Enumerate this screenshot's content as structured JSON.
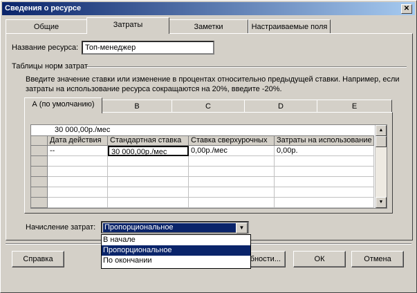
{
  "window": {
    "title": "Сведения о ресурсе",
    "close_glyph": "✕"
  },
  "tabs": [
    {
      "label": "Общие"
    },
    {
      "label": "Затраты"
    },
    {
      "label": "Заметки"
    },
    {
      "label": "Настраиваемые поля"
    }
  ],
  "resource": {
    "name_label": "Название ресурса:",
    "name_value": "Топ-менеджер"
  },
  "rates": {
    "group_label": "Таблицы норм затрат",
    "instruction_1": "Введите значение ставки или изменение в процентах относительно предыдущей ставки. Например, если",
    "instruction_2": "затраты на использование ресурса сокращаются на 20%, введите -20%.",
    "tabs": [
      {
        "label": "А (по умолчанию)"
      },
      {
        "label": "B"
      },
      {
        "label": "C"
      },
      {
        "label": "D"
      },
      {
        "label": "E"
      }
    ],
    "edit_value": "30 000,00р./мес",
    "columns": [
      "Дата действия",
      "Стандартная ставка",
      "Ставка сверхурочных",
      "Затраты на использование"
    ],
    "rows": [
      {
        "date": "--",
        "standard": "30 000,00р./мес",
        "overtime": "0,00р./мес",
        "per_use": "0,00р."
      }
    ]
  },
  "accrual": {
    "label": "Начисление затрат:",
    "selected": "Пропорциональное",
    "options": [
      "В начале",
      "Пропорциональное",
      "По окончании"
    ]
  },
  "buttons": {
    "help": "Справка",
    "details": "обности...",
    "ok": "ОК",
    "cancel": "Отмена"
  },
  "colors": {
    "title_active": "#0a246a",
    "selection": "#0a246a",
    "face": "#d4d0c8"
  }
}
